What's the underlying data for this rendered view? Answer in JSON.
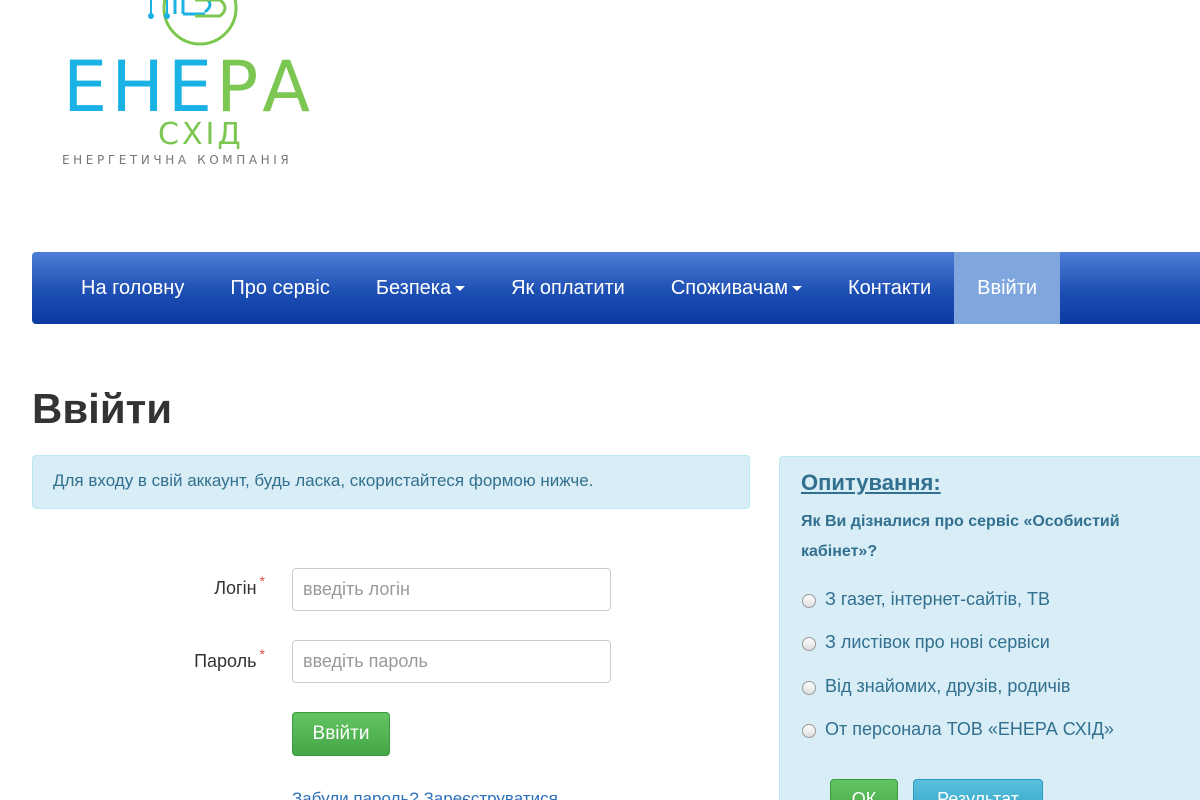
{
  "logo": {
    "word_part1": "ЕНЕ",
    "word_part2": "РА",
    "sub": "СХІД",
    "tagline": "ЕНЕРГЕТИЧНА КОМПАНІЯ",
    "colors": {
      "blue": "#1ab1e5",
      "green": "#7cc652"
    }
  },
  "nav": {
    "items": [
      {
        "label": "На головну"
      },
      {
        "label": "Про сервіс"
      },
      {
        "label": "Безпека"
      },
      {
        "label": "Як оплатити"
      },
      {
        "label": "Споживачам"
      },
      {
        "label": "Контакти"
      },
      {
        "label": "Ввійти"
      }
    ],
    "colors": {
      "bar": "#1d4fb3",
      "active": "#7fa7de"
    }
  },
  "page": {
    "title": "Ввійти"
  },
  "alert": {
    "text": "Для входу в свій аккаунт, будь ласка, скористайтеся формою нижче."
  },
  "form": {
    "login_label": "Логін",
    "login_placeholder": "введіть логін",
    "password_label": "Пароль",
    "password_placeholder": "введіть пароль",
    "required_mark": "*",
    "submit_label": "Ввійти",
    "forgot_link": "Забули пароль?",
    "register_link": "Зареєструватися"
  },
  "poll": {
    "title": "Опитування:",
    "question": "Як Ви дізналися про сервіс «Особистий кабінет»?",
    "options": [
      {
        "label": "З газет, інтернет-сайтів, ТВ"
      },
      {
        "label": "З листівок про нові сервіси"
      },
      {
        "label": "Від знайомих, друзів, родичів"
      },
      {
        "label": "От персонала ТОВ «ЕНЕРА СХІД»"
      }
    ],
    "ok_label": "ОК",
    "result_label": "Результат"
  }
}
